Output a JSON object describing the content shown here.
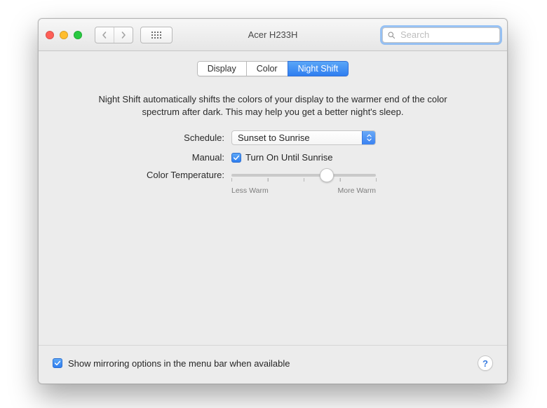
{
  "window": {
    "title": "Acer H233H",
    "search_placeholder": "Search"
  },
  "tabs": [
    {
      "label": "Display",
      "active": false
    },
    {
      "label": "Color",
      "active": false
    },
    {
      "label": "Night Shift",
      "active": true
    }
  ],
  "description": "Night Shift automatically shifts the colors of your display to the warmer end of the color spectrum after dark. This may help you get a better night's sleep.",
  "form": {
    "schedule_label": "Schedule:",
    "schedule_value": "Sunset to Sunrise",
    "manual_label": "Manual:",
    "manual_checkbox_label": "Turn On Until Sunrise",
    "manual_checked": true,
    "color_temp_label": "Color Temperature:",
    "color_temp_value_pct": 66,
    "color_temp_min_label": "Less Warm",
    "color_temp_max_label": "More Warm"
  },
  "footer": {
    "mirroring_label": "Show mirroring options in the menu bar when available",
    "mirroring_checked": true,
    "help_label": "?"
  }
}
